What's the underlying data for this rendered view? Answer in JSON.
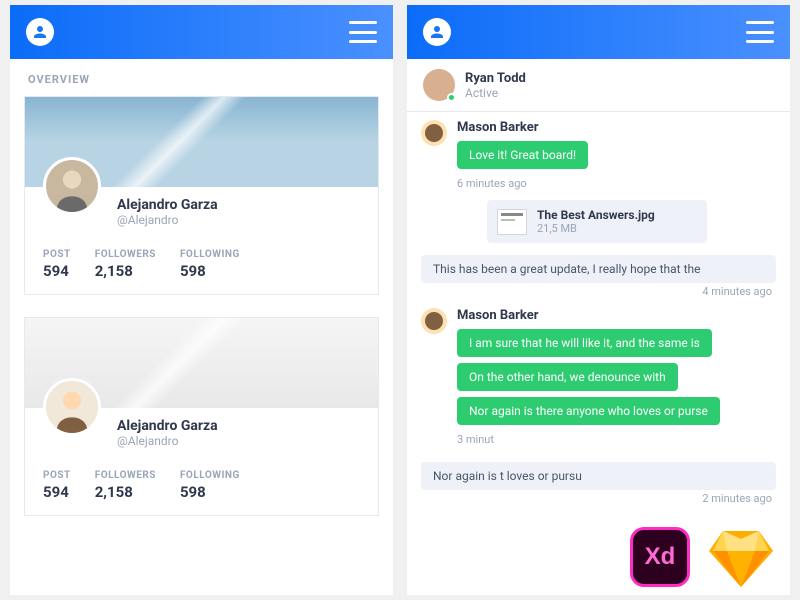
{
  "left": {
    "sectionLabel": "OVERVIEW",
    "profiles": [
      {
        "name": "Alejandro Garza",
        "handle": "@Alejandro",
        "stats": {
          "postLabel": "POST",
          "post": "594",
          "followersLabel": "FOLLOWERS",
          "followers": "2,158",
          "followingLabel": "FOLLOWING",
          "following": "598"
        }
      },
      {
        "name": "Alejandro Garza",
        "handle": "@Alejandro",
        "stats": {
          "postLabel": "POST",
          "post": "594",
          "followersLabel": "FOLLOWERS",
          "followers": "2,158",
          "followingLabel": "FOLLOWING",
          "following": "598"
        }
      }
    ]
  },
  "right": {
    "chatUser": {
      "name": "Ryan Todd",
      "status": "Active"
    },
    "thread": {
      "g1": {
        "author": "Mason Barker",
        "b1": "Love it! Great board!",
        "time": "6 minutes ago",
        "attachment": {
          "name": "The Best Answers.jpg",
          "size": "21,5 MB"
        }
      },
      "reply1": {
        "text": "This has been a great update, I really hope that the",
        "time": "4 minutes ago"
      },
      "g2": {
        "author": "Mason Barker",
        "b1": "I am sure that he will like it, and the same is",
        "b2": "On the other hand, we denounce with",
        "b3": "Nor again is there anyone who loves or purse",
        "time": "3 minut"
      },
      "reply2": {
        "text": "Nor again is t                        loves or pursu",
        "time": "2 minutes ago"
      }
    }
  },
  "badges": {
    "xd": "Xd"
  }
}
